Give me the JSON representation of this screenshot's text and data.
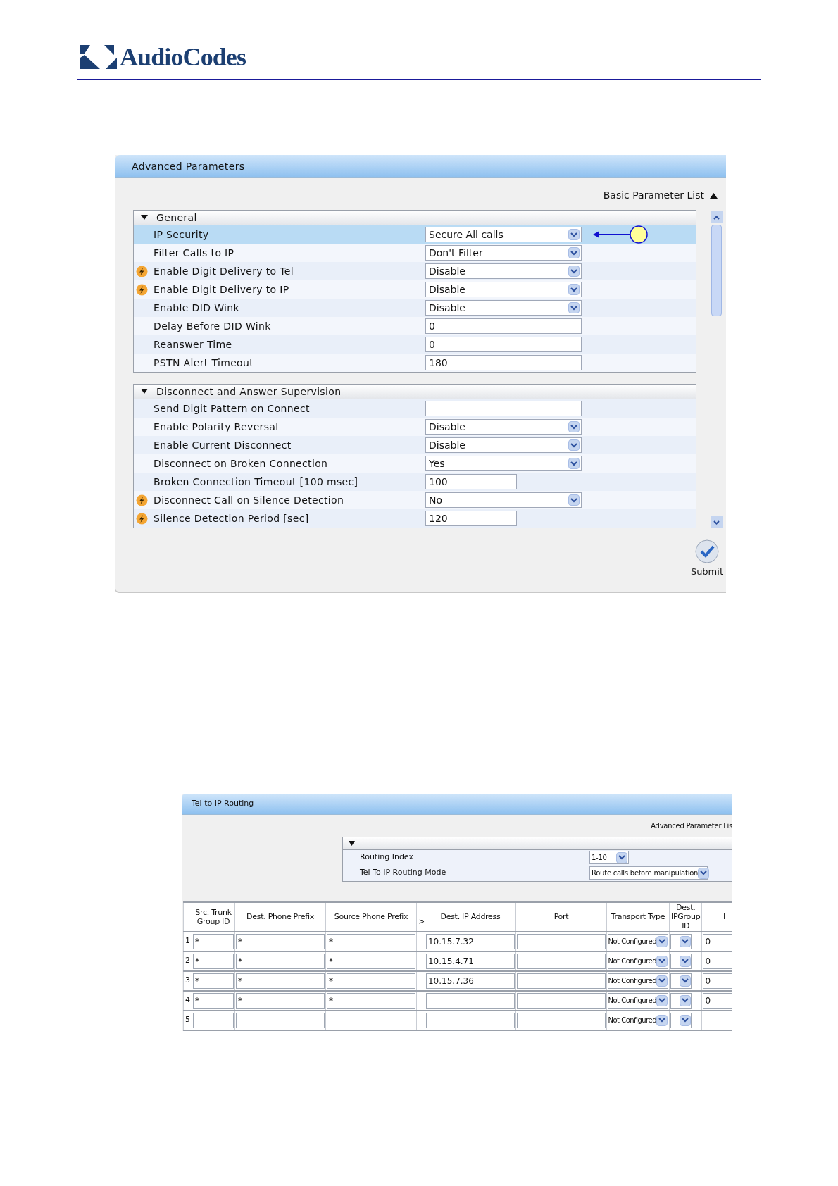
{
  "header": {
    "logo_text": "AudioCodes"
  },
  "advanced_parameters": {
    "title": "Advanced Parameters",
    "list_link": "Basic Parameter List",
    "sections": [
      {
        "title": "General",
        "expanded": true,
        "rows": [
          {
            "label": "IP Security",
            "kind": "select",
            "value": "Secure All calls",
            "flash": false,
            "selected": true,
            "annotated": true
          },
          {
            "label": "Filter Calls to IP",
            "kind": "select",
            "value": "Don't Filter",
            "flash": false,
            "selected": false,
            "annotated": false
          },
          {
            "label": "Enable Digit Delivery to Tel",
            "kind": "select",
            "value": "Disable",
            "flash": true,
            "selected": false,
            "annotated": false
          },
          {
            "label": "Enable Digit Delivery to IP",
            "kind": "select",
            "value": "Disable",
            "flash": true,
            "selected": false,
            "annotated": false
          },
          {
            "label": "Enable DID Wink",
            "kind": "select",
            "value": "Disable",
            "flash": false,
            "selected": false,
            "annotated": false
          },
          {
            "label": "Delay Before DID Wink",
            "kind": "text",
            "value": "0",
            "flash": false,
            "selected": false,
            "annotated": false
          },
          {
            "label": "Reanswer Time",
            "kind": "text",
            "value": "0",
            "flash": false,
            "selected": false,
            "annotated": false
          },
          {
            "label": "PSTN Alert Timeout",
            "kind": "text",
            "value": "180",
            "flash": false,
            "selected": false,
            "annotated": false
          }
        ]
      },
      {
        "title": "Disconnect and Answer Supervision",
        "expanded": true,
        "rows": [
          {
            "label": "Send Digit Pattern on Connect",
            "kind": "text",
            "flash": false,
            "selected": false,
            "annotated": false
          },
          {
            "label": "Enable Polarity Reversal",
            "kind": "select",
            "value": "Disable",
            "flash": false,
            "selected": false,
            "annotated": false
          },
          {
            "label": "Enable Current Disconnect",
            "kind": "select",
            "value": "Disable",
            "flash": false,
            "selected": false,
            "annotated": false
          },
          {
            "label": "Disconnect on Broken Connection",
            "kind": "select",
            "value": "Yes",
            "flash": false,
            "selected": false,
            "annotated": false
          },
          {
            "label": "Broken Connection Timeout [100 msec]",
            "kind": "short_text",
            "value": "100",
            "flash": false,
            "selected": false,
            "annotated": false
          },
          {
            "label": "Disconnect Call on Silence Detection",
            "kind": "select",
            "value": "No",
            "flash": true,
            "selected": false,
            "annotated": false
          },
          {
            "label": "Silence Detection Period [sec]",
            "kind": "short_text",
            "value": "120",
            "flash": true,
            "selected": false,
            "annotated": false
          }
        ]
      }
    ],
    "submit": "Submit"
  },
  "tel_to_ip_routing": {
    "title": "Tel to IP Routing",
    "list_link": "Advanced Parameter Lis",
    "params": [
      {
        "label": "Routing Index",
        "value": "1-10",
        "kind": "short_select"
      },
      {
        "label": "Tel To IP Routing Mode",
        "value": "Route calls before manipulation",
        "kind": "select"
      }
    ],
    "table": {
      "columns": [
        "Src. Trunk Group ID",
        "Dest. Phone Prefix",
        "Source Phone Prefix",
        "->",
        "Dest. IP Address",
        "Port",
        "Transport Type",
        "Dest. IPGroup ID",
        "I"
      ],
      "rows": [
        {
          "index": "1",
          "src_trunk_group": "*",
          "dest_prefix": "*",
          "source_prefix": "*",
          "dest_ip": "10.15.7.32",
          "transport": "Not Configured",
          "column_9": "0"
        },
        {
          "index": "2",
          "src_trunk_group": "*",
          "dest_prefix": "*",
          "source_prefix": "*",
          "dest_ip": "10.15.4.71",
          "transport": "Not Configured",
          "column_9": "0"
        },
        {
          "index": "3",
          "src_trunk_group": "*",
          "dest_prefix": "*",
          "source_prefix": "*",
          "dest_ip": "10.15.7.36",
          "transport": "Not Configured",
          "column_9": "0"
        },
        {
          "index": "4",
          "src_trunk_group": "*",
          "dest_prefix": "*",
          "source_prefix": "*",
          "transport": "Not Configured",
          "column_9": "0"
        },
        {
          "index": "5",
          "transport": "Not Configured"
        }
      ]
    }
  }
}
